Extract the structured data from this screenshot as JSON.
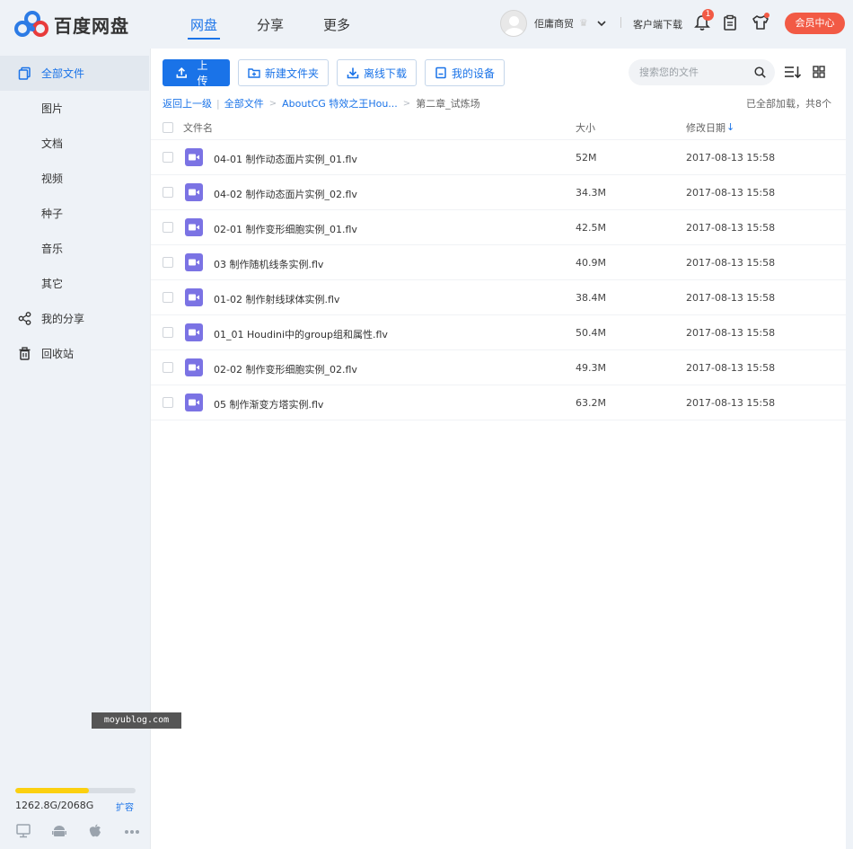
{
  "app": {
    "logo_text": "百度网盘"
  },
  "nav": [
    {
      "label": "网盘",
      "active": true
    },
    {
      "label": "分享",
      "active": false
    },
    {
      "label": "更多",
      "active": false
    }
  ],
  "user": {
    "name": "佢庸商贸",
    "client_download": "客户端下载",
    "notification_count": "1",
    "vip_button": "会员中心"
  },
  "sidebar": {
    "items": [
      {
        "label": "全部文件",
        "icon": "folder-icon",
        "active": true
      },
      {
        "label": "图片"
      },
      {
        "label": "文档"
      },
      {
        "label": "视频"
      },
      {
        "label": "种子"
      },
      {
        "label": "音乐"
      },
      {
        "label": "其它"
      },
      {
        "label": "我的分享",
        "icon": "share-icon"
      },
      {
        "label": "回收站",
        "icon": "trash-icon"
      }
    ],
    "quota_used_fraction": 0.61,
    "quota_text": "1262.8G/2068G",
    "expand_label": "扩容"
  },
  "toolbar": {
    "upload": "上传",
    "new_folder": "新建文件夹",
    "offline_download": "离线下载",
    "my_devices": "我的设备",
    "search_placeholder": "搜索您的文件"
  },
  "breadcrumb": {
    "back": "返回上一级",
    "sep": "|",
    "items": [
      "全部文件",
      "AboutCG 特效之王Hou..."
    ],
    "arrow": ">",
    "current": "第二章_试炼场",
    "loaded": "已全部加载，共8个"
  },
  "table": {
    "headers": {
      "name": "文件名",
      "size": "大小",
      "date": "修改日期",
      "sort_arrow": "↓"
    },
    "rows": [
      {
        "name": "04-01 制作动态面片实例_01.flv",
        "size": "52M",
        "date": "2017-08-13 15:58"
      },
      {
        "name": "04-02 制作动态面片实例_02.flv",
        "size": "34.3M",
        "date": "2017-08-13 15:58"
      },
      {
        "name": "02-01 制作变形细胞实例_01.flv",
        "size": "42.5M",
        "date": "2017-08-13 15:58"
      },
      {
        "name": "03 制作随机线条实例.flv",
        "size": "40.9M",
        "date": "2017-08-13 15:58"
      },
      {
        "name": "01-02 制作射线球体实例.flv",
        "size": "38.4M",
        "date": "2017-08-13 15:58"
      },
      {
        "name": "01_01 Houdini中的group组和属性.flv",
        "size": "50.4M",
        "date": "2017-08-13 15:58"
      },
      {
        "name": "02-02 制作变形细胞实例_02.flv",
        "size": "49.3M",
        "date": "2017-08-13 15:58"
      },
      {
        "name": "05 制作渐变方塔实例.flv",
        "size": "63.2M",
        "date": "2017-08-13 15:58"
      }
    ]
  },
  "watermark": "moyublog.com",
  "colors": {
    "accent": "#1a73e8",
    "vip": "#f25a45",
    "quota": "#fbd010",
    "video_icon": "#7b73e4"
  }
}
